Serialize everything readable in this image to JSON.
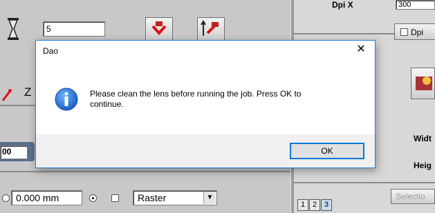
{
  "background_app": {
    "top_field_value": "5",
    "axis_label": "Z",
    "partial_field_value": "00",
    "distance_value": "0.000 mm",
    "mode_select_value": "Raster",
    "right_top_label": "Dpi X",
    "right_top_value": "300",
    "dpi_checkbox_label": "Dpi",
    "width_label": "Widt",
    "height_label": "Heig",
    "tabs": [
      "1",
      "2",
      "3"
    ],
    "selection_button_label": "Selectio"
  },
  "dialog": {
    "title": "Dao",
    "close_glyph": "✕",
    "message_line1": "Please clean the lens before running the job. Press OK to",
    "message_line2": "continue.",
    "ok_label": "OK",
    "info_color": "#1a6fd1"
  }
}
